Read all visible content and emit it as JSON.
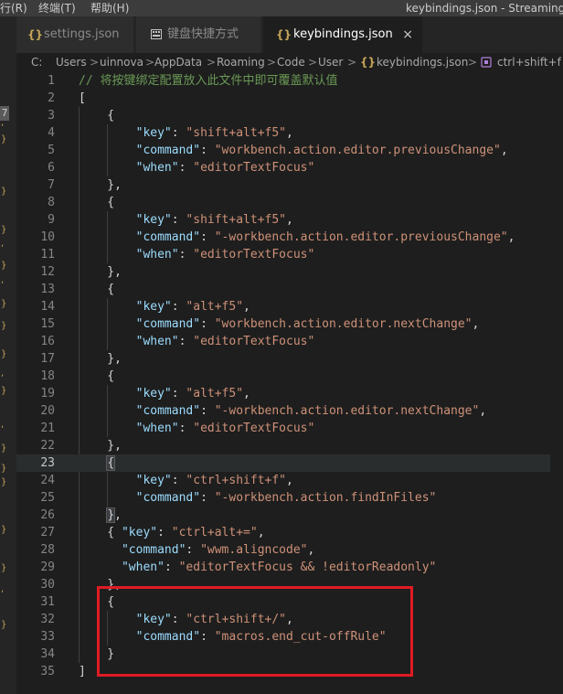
{
  "menubar": {
    "items": [
      "行(R)",
      "终端(T)",
      "帮助(H)"
    ],
    "window_title": "keybindings.json - StreamingAss"
  },
  "sidebar_stub": {
    "badge": "7",
    "marks": [
      ",",
      "}",
      "}",
      "}",
      ",",
      "}",
      ",",
      "}",
      "}",
      "}",
      ",",
      "}",
      ",",
      "}",
      "}",
      "}",
      "}",
      "}",
      ",",
      "}"
    ]
  },
  "tabs": [
    {
      "label": "settings.json",
      "icon": "json-braces-icon",
      "active": false
    },
    {
      "label": "键盘快捷方式",
      "icon": "keyboard-shortcuts-icon",
      "active": false
    },
    {
      "label": "keybindings.json",
      "icon": "json-braces-icon",
      "active": true,
      "close": "×"
    }
  ],
  "breadcrumb": {
    "segments": [
      "C:",
      "Users",
      "uinnova",
      "AppData",
      "Roaming",
      "Code",
      "User",
      "keybindings.json",
      "ctrl+shift+f"
    ],
    "separator": ">"
  },
  "editor": {
    "current_line": 23,
    "lines": [
      {
        "n": "1",
        "tokens": [
          [
            "c",
            "// 将按键绑定配置放入此文件中即可覆盖默认值"
          ]
        ]
      },
      {
        "n": "2",
        "tokens": [
          [
            "p",
            "["
          ]
        ]
      },
      {
        "n": "3",
        "tokens": [
          [
            "p",
            "    {"
          ]
        ]
      },
      {
        "n": "4",
        "tokens": [
          [
            "p",
            "        "
          ],
          [
            "k",
            "\"key\""
          ],
          [
            "p",
            ": "
          ],
          [
            "s",
            "\"shift+alt+f5\""
          ],
          [
            "p",
            ","
          ]
        ]
      },
      {
        "n": "5",
        "tokens": [
          [
            "p",
            "        "
          ],
          [
            "k",
            "\"command\""
          ],
          [
            "p",
            ": "
          ],
          [
            "s",
            "\"workbench.action.editor.previousChange\""
          ],
          [
            "p",
            ","
          ]
        ]
      },
      {
        "n": "6",
        "tokens": [
          [
            "p",
            "        "
          ],
          [
            "k",
            "\"when\""
          ],
          [
            "p",
            ": "
          ],
          [
            "s",
            "\"editorTextFocus\""
          ]
        ]
      },
      {
        "n": "7",
        "tokens": [
          [
            "p",
            "    },"
          ]
        ]
      },
      {
        "n": "8",
        "tokens": [
          [
            "p",
            "    {"
          ]
        ]
      },
      {
        "n": "9",
        "tokens": [
          [
            "p",
            "        "
          ],
          [
            "k",
            "\"key\""
          ],
          [
            "p",
            ": "
          ],
          [
            "s",
            "\"shift+alt+f5\""
          ],
          [
            "p",
            ","
          ]
        ]
      },
      {
        "n": "10",
        "tokens": [
          [
            "p",
            "        "
          ],
          [
            "k",
            "\"command\""
          ],
          [
            "p",
            ": "
          ],
          [
            "s",
            "\"-workbench.action.editor.previousChange\""
          ],
          [
            "p",
            ","
          ]
        ]
      },
      {
        "n": "11",
        "tokens": [
          [
            "p",
            "        "
          ],
          [
            "k",
            "\"when\""
          ],
          [
            "p",
            ": "
          ],
          [
            "s",
            "\"editorTextFocus\""
          ]
        ]
      },
      {
        "n": "12",
        "tokens": [
          [
            "p",
            "    },"
          ]
        ]
      },
      {
        "n": "13",
        "tokens": [
          [
            "p",
            "    {"
          ]
        ]
      },
      {
        "n": "14",
        "tokens": [
          [
            "p",
            "        "
          ],
          [
            "k",
            "\"key\""
          ],
          [
            "p",
            ": "
          ],
          [
            "s",
            "\"alt+f5\""
          ],
          [
            "p",
            ","
          ]
        ]
      },
      {
        "n": "15",
        "tokens": [
          [
            "p",
            "        "
          ],
          [
            "k",
            "\"command\""
          ],
          [
            "p",
            ": "
          ],
          [
            "s",
            "\"workbench.action.editor.nextChange\""
          ],
          [
            "p",
            ","
          ]
        ]
      },
      {
        "n": "16",
        "tokens": [
          [
            "p",
            "        "
          ],
          [
            "k",
            "\"when\""
          ],
          [
            "p",
            ": "
          ],
          [
            "s",
            "\"editorTextFocus\""
          ]
        ]
      },
      {
        "n": "17",
        "tokens": [
          [
            "p",
            "    },"
          ]
        ]
      },
      {
        "n": "18",
        "tokens": [
          [
            "p",
            "    {"
          ]
        ]
      },
      {
        "n": "19",
        "tokens": [
          [
            "p",
            "        "
          ],
          [
            "k",
            "\"key\""
          ],
          [
            "p",
            ": "
          ],
          [
            "s",
            "\"alt+f5\""
          ],
          [
            "p",
            ","
          ]
        ]
      },
      {
        "n": "20",
        "tokens": [
          [
            "p",
            "        "
          ],
          [
            "k",
            "\"command\""
          ],
          [
            "p",
            ": "
          ],
          [
            "s",
            "\"-workbench.action.editor.nextChange\""
          ],
          [
            "p",
            ","
          ]
        ]
      },
      {
        "n": "21",
        "tokens": [
          [
            "p",
            "        "
          ],
          [
            "k",
            "\"when\""
          ],
          [
            "p",
            ": "
          ],
          [
            "s",
            "\"editorTextFocus\""
          ]
        ]
      },
      {
        "n": "22",
        "tokens": [
          [
            "p",
            "    },"
          ]
        ]
      },
      {
        "n": "23",
        "tokens": [
          [
            "p",
            "    "
          ],
          [
            "sel",
            "{"
          ]
        ]
      },
      {
        "n": "24",
        "tokens": [
          [
            "p",
            "        "
          ],
          [
            "k",
            "\"key\""
          ],
          [
            "p",
            ": "
          ],
          [
            "s",
            "\"ctrl+shift+f\""
          ],
          [
            "p",
            ","
          ]
        ]
      },
      {
        "n": "25",
        "tokens": [
          [
            "p",
            "        "
          ],
          [
            "k",
            "\"command\""
          ],
          [
            "p",
            ": "
          ],
          [
            "s",
            "\"-workbench.action.findInFiles\""
          ]
        ]
      },
      {
        "n": "26",
        "tokens": [
          [
            "p",
            "    "
          ],
          [
            "sel",
            "}"
          ],
          [
            "p",
            ","
          ]
        ]
      },
      {
        "n": "27",
        "tokens": [
          [
            "p",
            "    { "
          ],
          [
            "k",
            "\"key\""
          ],
          [
            "p",
            ": "
          ],
          [
            "s",
            "\"ctrl+alt+=\""
          ],
          [
            "p",
            ","
          ]
        ]
      },
      {
        "n": "28",
        "tokens": [
          [
            "p",
            "      "
          ],
          [
            "k",
            "\"command\""
          ],
          [
            "p",
            ": "
          ],
          [
            "s",
            "\"wwm.aligncode\""
          ],
          [
            "p",
            ","
          ]
        ]
      },
      {
        "n": "29",
        "tokens": [
          [
            "p",
            "      "
          ],
          [
            "k",
            "\"when\""
          ],
          [
            "p",
            ": "
          ],
          [
            "s",
            "\"editorTextFocus && !editorReadonly\""
          ]
        ]
      },
      {
        "n": "30",
        "tokens": [
          [
            "p",
            "    },"
          ]
        ]
      },
      {
        "n": "31",
        "tokens": [
          [
            "p",
            "    {"
          ]
        ]
      },
      {
        "n": "32",
        "tokens": [
          [
            "p",
            "        "
          ],
          [
            "k",
            "\"key\""
          ],
          [
            "p",
            ": "
          ],
          [
            "s",
            "\"ctrl+shift+/\""
          ],
          [
            "p",
            ","
          ]
        ]
      },
      {
        "n": "33",
        "tokens": [
          [
            "p",
            "        "
          ],
          [
            "k",
            "\"command\""
          ],
          [
            "p",
            ": "
          ],
          [
            "s",
            "\"macros.end_cut-offRule\""
          ]
        ]
      },
      {
        "n": "34",
        "tokens": [
          [
            "p",
            "    }"
          ]
        ]
      },
      {
        "n": "35",
        "tokens": [
          [
            "p",
            "]"
          ]
        ]
      }
    ]
  },
  "colors": {
    "editor_bg": "#1e1e1e",
    "key": "#9cdcfe",
    "string": "#ce9178",
    "comment": "#6a9955",
    "annotation_box": "#e01b24"
  }
}
